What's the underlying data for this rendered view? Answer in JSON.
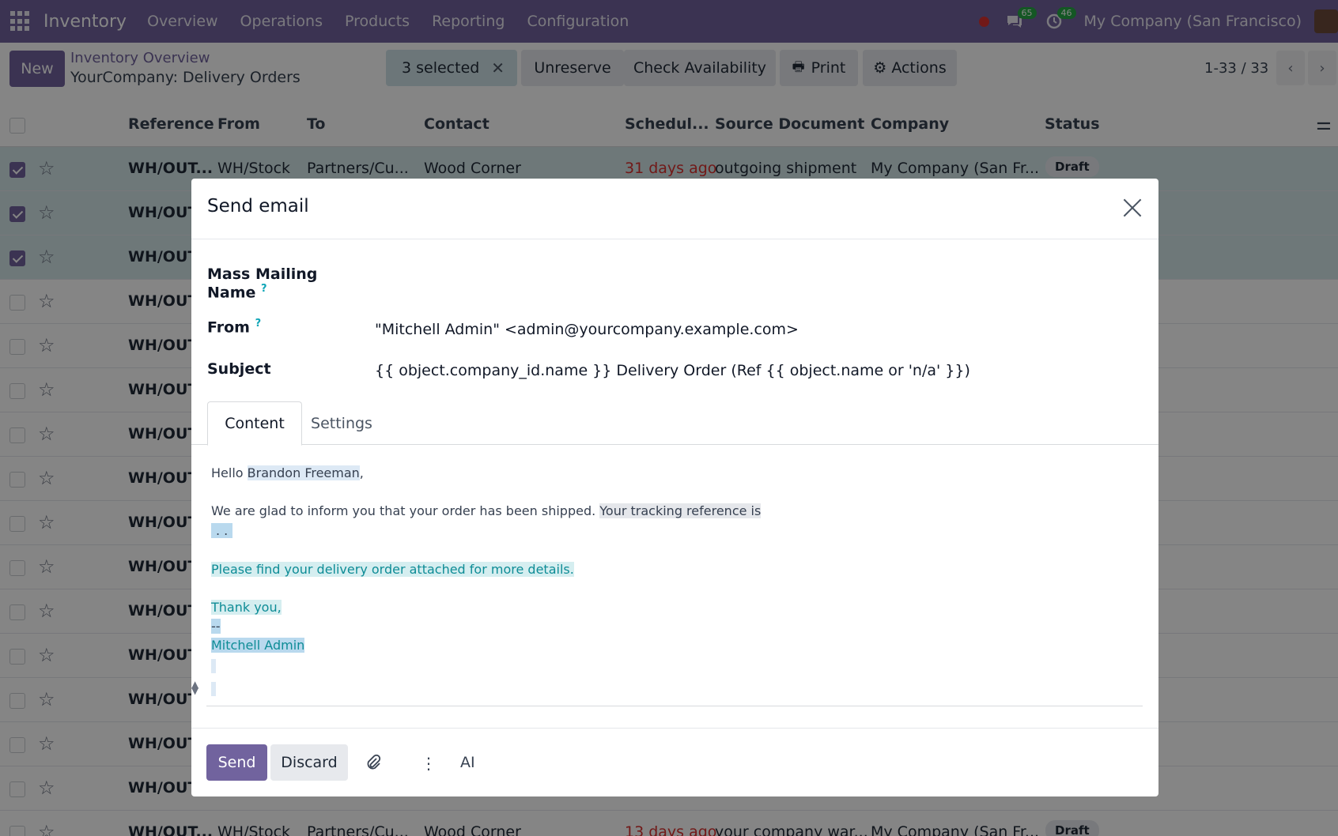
{
  "topnav": {
    "app_name": "Inventory",
    "menu": [
      "Overview",
      "Operations",
      "Products",
      "Reporting",
      "Configuration"
    ],
    "messages_count": "65",
    "activities_count": "46",
    "company": "My Company (San Francisco)"
  },
  "control": {
    "new_label": "New",
    "breadcrumb_parent": "Inventory Overview",
    "breadcrumb_current": "YourCompany: Delivery Orders",
    "selected_label": "3 selected",
    "unreserve_label": "Unreserve",
    "check_availability_label": "Check Availability",
    "print_label": "Print",
    "actions_label": "Actions",
    "pager": "1-33 / 33"
  },
  "list": {
    "headers": [
      "Reference",
      "From",
      "To",
      "Contact",
      "Schedul...",
      "Source Document",
      "Company",
      "Status"
    ],
    "rows": [
      {
        "ref": "WH/OUT...",
        "from": "WH/Stock",
        "to": "Partners/Cu...",
        "contact": "Wood Corner",
        "scheduled": "31 days ago",
        "source": "outgoing shipment",
        "company": "My Company (San Fr...",
        "status": "Draft",
        "selected": true
      },
      {
        "ref": "WH/OUT",
        "selected": true
      },
      {
        "ref": "WH/OUT",
        "selected": true
      },
      {
        "ref": "WH/OUT",
        "selected": false
      },
      {
        "ref": "WH/OUT",
        "selected": false
      },
      {
        "ref": "WH/OUT",
        "selected": false
      },
      {
        "ref": "WH/OUT",
        "selected": false
      },
      {
        "ref": "WH/OUT",
        "selected": false
      },
      {
        "ref": "WH/OUT",
        "selected": false
      },
      {
        "ref": "WH/OUT",
        "selected": false
      },
      {
        "ref": "WH/OUT",
        "selected": false
      },
      {
        "ref": "WH/OUT",
        "selected": false
      },
      {
        "ref": "WH/OUT",
        "selected": false
      },
      {
        "ref": "WH/OUT",
        "selected": false
      },
      {
        "ref": "WH/OUT",
        "selected": false
      },
      {
        "ref": "WH/OUT...",
        "from": "WH/Stock",
        "to": "Partners/Cu...",
        "contact": "Wood Corner",
        "scheduled": "13 days ago",
        "source": "your company war...",
        "company": "My Company (San Fr...",
        "status": "Draft",
        "selected": false
      }
    ]
  },
  "modal": {
    "title": "Send email",
    "mass_mailing_label_1": "Mass Mailing",
    "mass_mailing_label_2": "Name",
    "from_label": "From",
    "from_value": "\"Mitchell Admin\" <admin@yourcompany.example.com>",
    "subject_label": "Subject",
    "subject_value": "{{ object.company_id.name }} Delivery Order (Ref {{ object.name or 'n/a' }})",
    "help_mark": "?",
    "tabs": [
      "Content",
      "Settings"
    ],
    "body": {
      "hello": "Hello ",
      "recipient": "Brandon Freeman",
      "comma": ",",
      "line1": "We are glad to inform you that your order has been shipped. ",
      "line1_highlight": "Your tracking reference is",
      "tracking_placeholder": ". .",
      "line2": "Please find your delivery order attached for more details.",
      "thanks": "Thank you,",
      "sig_sep": "--",
      "signature": "Mitchell Admin"
    },
    "send_label": "Send",
    "discard_label": "Discard",
    "ai_label": "AI"
  },
  "colors": {
    "brand": "#71639e",
    "selected_row": "#d3e6e9",
    "overdue": "#d9312e"
  }
}
